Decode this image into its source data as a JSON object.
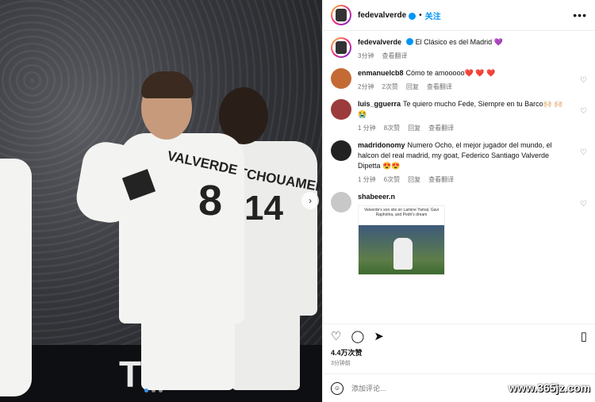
{
  "header": {
    "username": "fedevalverde",
    "separator": "•",
    "follow_label": "关注",
    "more_icon": "more-horizontal-icon"
  },
  "photo": {
    "banner_text": "TI",
    "jersey_left_name": "VALVERDE",
    "jersey_left_number": "8",
    "jersey_right_name": "TCHOUAMENI",
    "jersey_right_number": "14"
  },
  "caption": {
    "username": "fedevalverde",
    "text": "El Clásico es del Madrid 💜",
    "time": "3分钟",
    "translate": "查看翻译"
  },
  "comments": [
    {
      "username": "enmanuelcb8",
      "text": "Cómo te amooooo",
      "hearts": "❤️ ❤️ ❤️",
      "time": "2分钟",
      "likes": "2次赞",
      "reply": "回复",
      "translate": "查看翻译",
      "avatar_color": "#c46a34"
    },
    {
      "username": "luis_gguerra",
      "text": "Te quiero mucho Fede, Siempre en tu Barco🙌🏻 🙌🏻 😭",
      "time": "1 分钟",
      "likes": "8次赞",
      "reply": "回复",
      "translate": "查看翻译",
      "avatar_color": "#9c3b3b"
    },
    {
      "username": "madridonomy",
      "text": "Numero Ocho, el mejor jugador del mundo, el halcon del real madrid, my goat, Federico Santiago Valverde Dipetta 😍😍",
      "time": "1 分钟",
      "likes": "6次赞",
      "reply": "回复",
      "translate": "查看翻译",
      "avatar_color": "#222222"
    },
    {
      "username": "shabeeer.n",
      "text": "",
      "time": "",
      "likes": "",
      "reply": "",
      "translate": "",
      "avatar_color": "#c8c8c8",
      "image_caption": "Valverde's son sits on Lamine Yamal, Gavi Raphinha, and Pedri's dream"
    }
  ],
  "actions": {
    "like_icon": "heart-icon",
    "comment_icon": "comment-icon",
    "share_icon": "send-icon",
    "save_icon": "bookmark-icon"
  },
  "likes": "4.4万次赞",
  "posted": "3分钟前",
  "add_comment": {
    "placeholder": "添加评论..."
  },
  "watermark": "www.365jz.com"
}
